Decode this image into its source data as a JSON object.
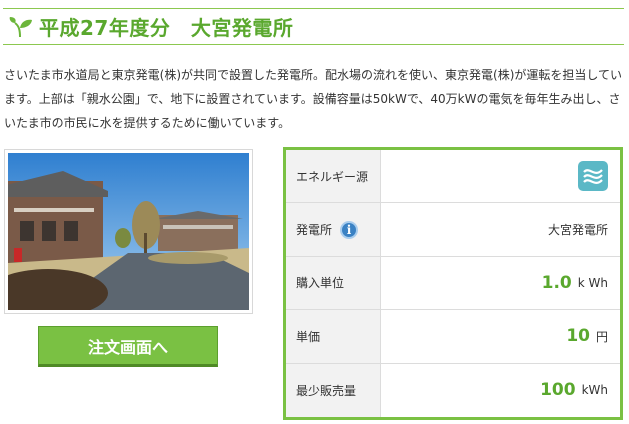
{
  "header": {
    "title": "平成27年度分　大宮発電所",
    "leaf_icon": "leaf-icon"
  },
  "description": "さいたま市水道局と東京発電(株)が共同で設置した発電所。配水場の流れを使い、東京発電(株)が運転を担当しています。上部は「親水公園」で、地下に設置されています。設備容量は50kWで、40万kWの電気を毎年生み出し、さいたま市の市民に水を提供するために働いています。",
  "order_button": {
    "label": "注文画面へ"
  },
  "colors": {
    "accent_green": "#5aa82e",
    "button_green": "#7ac143",
    "water_icon_bg": "#5bb8c6"
  },
  "table": {
    "rows": [
      {
        "label": "エネルギー源",
        "icon": "water-energy-icon"
      },
      {
        "label": "発電所",
        "value": "大宮発電所",
        "icon": "info-icon"
      },
      {
        "label": "購入単位",
        "number": "1.0",
        "unit": "k Wh"
      },
      {
        "label": "単価",
        "number": "10",
        "unit": "円"
      },
      {
        "label": "最少販売量",
        "number": "100",
        "unit": "kWh"
      }
    ]
  }
}
